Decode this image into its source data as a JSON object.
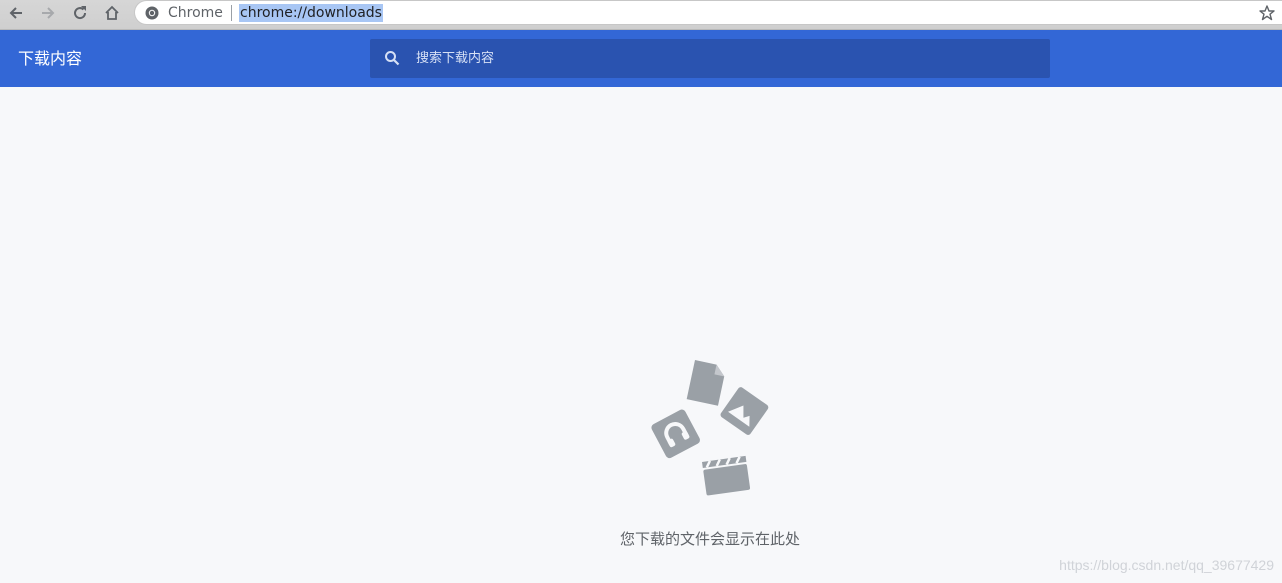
{
  "browser": {
    "site_name": "Chrome",
    "url": "chrome://downloads"
  },
  "header": {
    "title": "下载内容",
    "search_placeholder": "搜索下载内容"
  },
  "empty_state": {
    "message": "您下载的文件会显示在此处"
  },
  "watermark": "https://blog.csdn.net/qq_39677429",
  "colors": {
    "header_bg": "#3367d6",
    "search_bg": "#2a53b0",
    "page_bg": "#f7f8fa",
    "icon_gray": "#9aa0a6"
  },
  "icons": [
    "back-icon",
    "forward-icon",
    "reload-icon",
    "home-icon",
    "chrome-site-icon",
    "bookmark-star-icon",
    "search-icon",
    "document-icon",
    "image-icon",
    "audio-icon",
    "video-icon"
  ]
}
